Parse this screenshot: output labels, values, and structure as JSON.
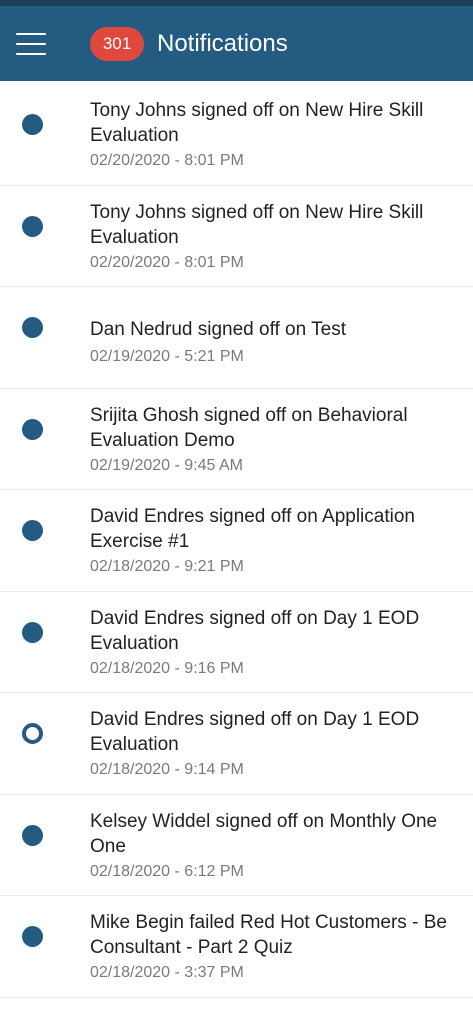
{
  "header": {
    "badge_count": "301",
    "title": "Notifications",
    "menu_icon": "hamburger-menu-icon"
  },
  "colors": {
    "header_bg": "#245b80",
    "badge_bg": "#e0483d",
    "dot": "#245b80"
  },
  "notifications": [
    {
      "message": "Tony Johns signed off on New Hire Skill\nEvaluation",
      "timestamp": "02/20/2020 - 8:01 PM",
      "read": false
    },
    {
      "message": "Tony Johns signed off on New Hire Skill\nEvaluation",
      "timestamp": "02/20/2020 - 8:01 PM",
      "read": false
    },
    {
      "message": "Dan Nedrud signed off on Test",
      "timestamp": "02/19/2020 - 5:21 PM",
      "read": false
    },
    {
      "message": "Srijita Ghosh signed off on Behavioral\nEvaluation Demo",
      "timestamp": "02/19/2020 - 9:45 AM",
      "read": false
    },
    {
      "message": "David Endres signed off on Application\nExercise #1",
      "timestamp": "02/18/2020 - 9:21 PM",
      "read": false
    },
    {
      "message": "David Endres signed off on Day 1 EOD\nEvaluation",
      "timestamp": "02/18/2020 - 9:16 PM",
      "read": false
    },
    {
      "message": "David Endres signed off on Day 1 EOD\nEvaluation",
      "timestamp": "02/18/2020 - 9:14 PM",
      "read": true
    },
    {
      "message": "Kelsey Widdel signed off on Monthly One\nOne",
      "timestamp": "02/18/2020 - 6:12 PM",
      "read": false
    },
    {
      "message": "Mike Begin failed Red Hot Customers - Be\nConsultant - Part 2 Quiz",
      "timestamp": "02/18/2020 - 3:37 PM",
      "read": false
    }
  ]
}
